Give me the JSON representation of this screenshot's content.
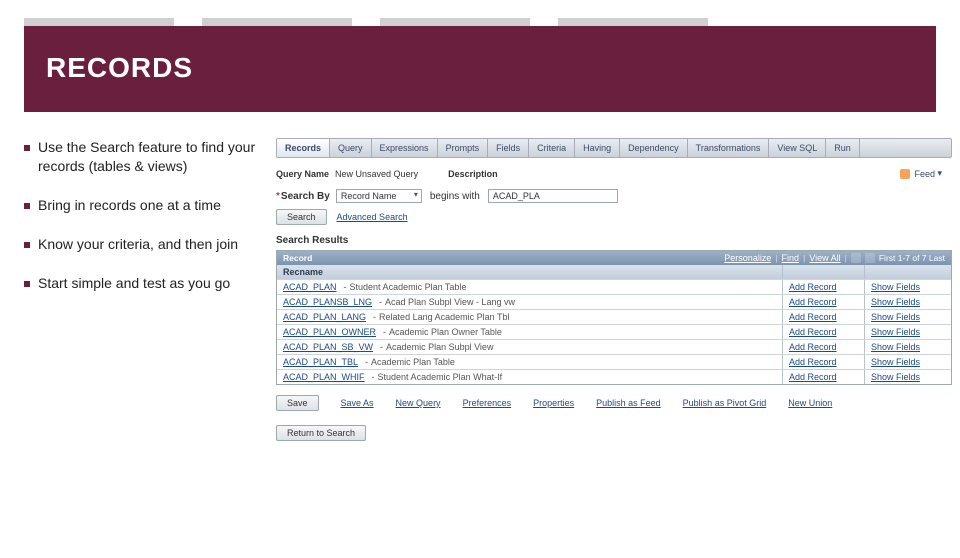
{
  "title": "RECORDS",
  "bullets": [
    "Use the Search feature to find your records (tables & views)",
    "Bring in   records   one at a time",
    "Know your criteria, and then join",
    "Start simple and test as you go"
  ],
  "tabs": [
    "Records",
    "Query",
    "Expressions",
    "Prompts",
    "Fields",
    "Criteria",
    "Having",
    "Dependency",
    "Transformations",
    "View SQL",
    "Run"
  ],
  "meta": {
    "query_name_label": "Query Name",
    "query_name_value": "New Unsaved Query",
    "description_label": "Description",
    "feed_label": "Feed"
  },
  "search": {
    "label": "Search By",
    "select_value": "Record Name",
    "begins": "begins with",
    "input_value": "ACAD_PLA",
    "search_btn": "Search",
    "advanced": "Advanced Search"
  },
  "results_title": "Search Results",
  "grid": {
    "main_title": "Record",
    "toolbar": {
      "personalize": "Personalize",
      "find": "Find",
      "viewall": "View All",
      "range": "First 1-7 of 7 Last"
    },
    "cols": [
      "Recname",
      "",
      ""
    ],
    "add_label": "Add Record",
    "show_label": "Show Fields",
    "rows": [
      {
        "code": "ACAD_PLAN",
        "desc": "Student Academic Plan Table"
      },
      {
        "code": "ACAD_PLANSB_LNG",
        "desc": "Acad Plan Subpl View - Lang vw"
      },
      {
        "code": "ACAD_PLAN_LANG",
        "desc": "Related Lang Academic Plan Tbl"
      },
      {
        "code": "ACAD_PLAN_OWNER",
        "desc": "Academic Plan Owner Table"
      },
      {
        "code": "ACAD_PLAN_SB_VW",
        "desc": "Academic Plan Subpl View"
      },
      {
        "code": "ACAD_PLAN_TBL",
        "desc": "Academic Plan Table"
      },
      {
        "code": "ACAD_PLAN_WHIF",
        "desc": "Student Academic Plan What-If"
      }
    ]
  },
  "bottom": {
    "save": "Save",
    "links": [
      "Save As",
      "New Query",
      "Preferences",
      "Properties",
      "Publish as Feed",
      "Publish as Pivot Grid",
      "New Union"
    ],
    "return": "Return to Search"
  }
}
